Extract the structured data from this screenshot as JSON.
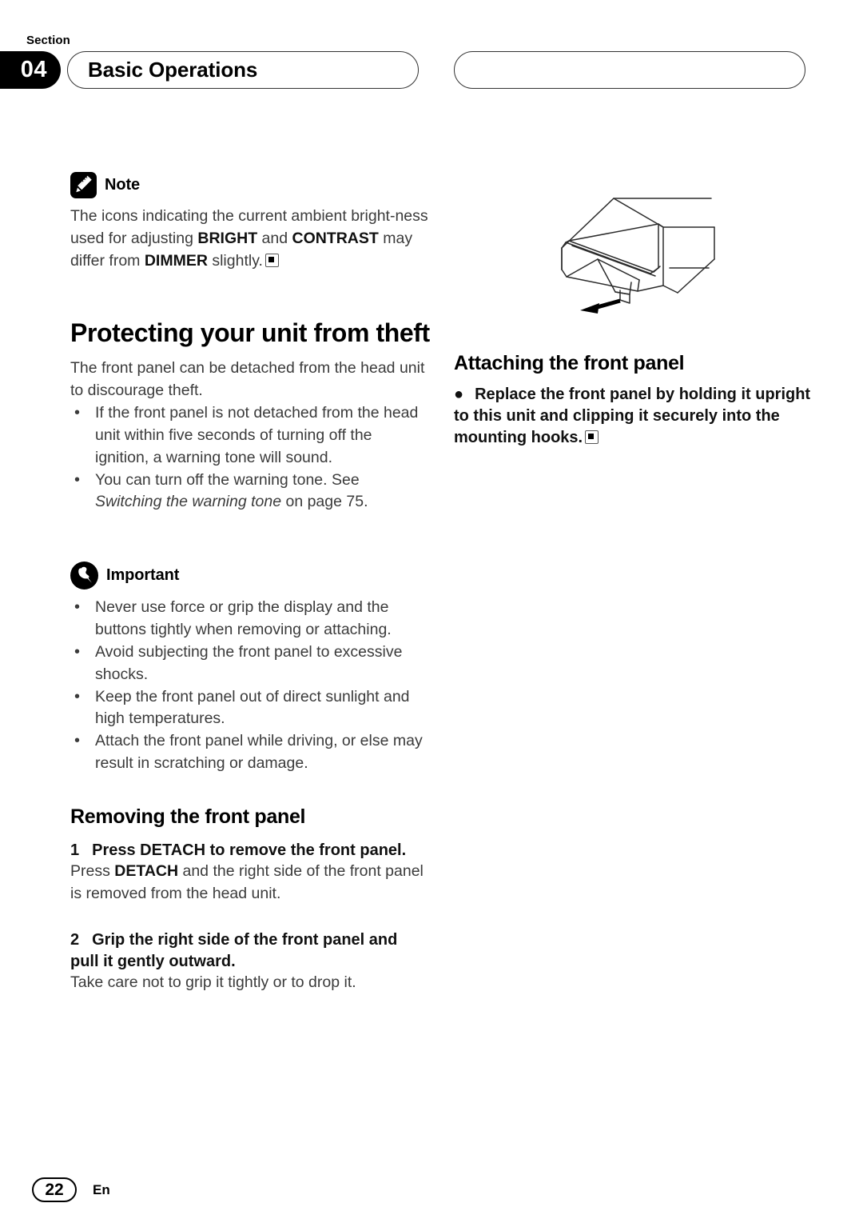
{
  "header": {
    "section_word": "Section",
    "section_number": "04",
    "chapter_title": "Basic Operations",
    "right_pill_title": ""
  },
  "left_column": {
    "note": {
      "icon": "pencil-icon",
      "label": "Note",
      "text_part1": "The icons indicating the current ambient bright-ness used for adjusting ",
      "bold1": "BRIGHT",
      "text_part2": " and ",
      "bold2": "CONTRAST",
      "text_part3": " may differ from ",
      "bold3": "DIMMER",
      "text_part4": " slightly."
    },
    "section_heading": "Protecting your unit from theft",
    "intro": "The front panel can be detached from the head unit to discourage theft.",
    "bullets": [
      {
        "text": "If the front panel is not detached from the head unit within five seconds of turning off the ignition, a warning tone will sound."
      },
      {
        "text_before": "You can turn off the warning tone. See ",
        "italic": "Switching the warning tone",
        "text_after": " on page 75."
      }
    ],
    "important": {
      "icon": "pushpin-icon",
      "label": "Important",
      "bullets": [
        "Never use force or grip the display and the buttons tightly when removing or attaching.",
        "Avoid subjecting the front panel to excessive shocks.",
        "Keep the front panel out of direct sunlight and high temperatures.",
        "Attach the front panel while driving, or else may result in scratching or damage."
      ]
    },
    "removing": {
      "heading": "Removing the front panel",
      "steps": [
        {
          "number": "1",
          "instruction": "Press DETACH to remove the front panel.",
          "detail_before": "Press ",
          "detail_bold": "DETACH",
          "detail_after": " and the right side of the front panel is removed from the head unit."
        },
        {
          "number": "2",
          "instruction": "Grip the right side of the front panel and pull it gently outward.",
          "detail_before": "Take care not to grip it tightly or to drop it.",
          "detail_bold": "",
          "detail_after": ""
        }
      ]
    }
  },
  "right_column": {
    "figure": {
      "name": "head-unit-front-panel-detach-illustration",
      "caption": ""
    },
    "attaching": {
      "heading": "Attaching the front panel",
      "bullet_marker": "●",
      "instruction": "Replace the front panel by holding it upright to this unit and clipping it securely into the mounting hooks."
    }
  },
  "footer": {
    "page_number": "22",
    "language": "En"
  },
  "colors": {
    "ink": "#000000",
    "body_text": "#3b3b3b",
    "rule": "#333333",
    "page_background": "#ffffff"
  }
}
